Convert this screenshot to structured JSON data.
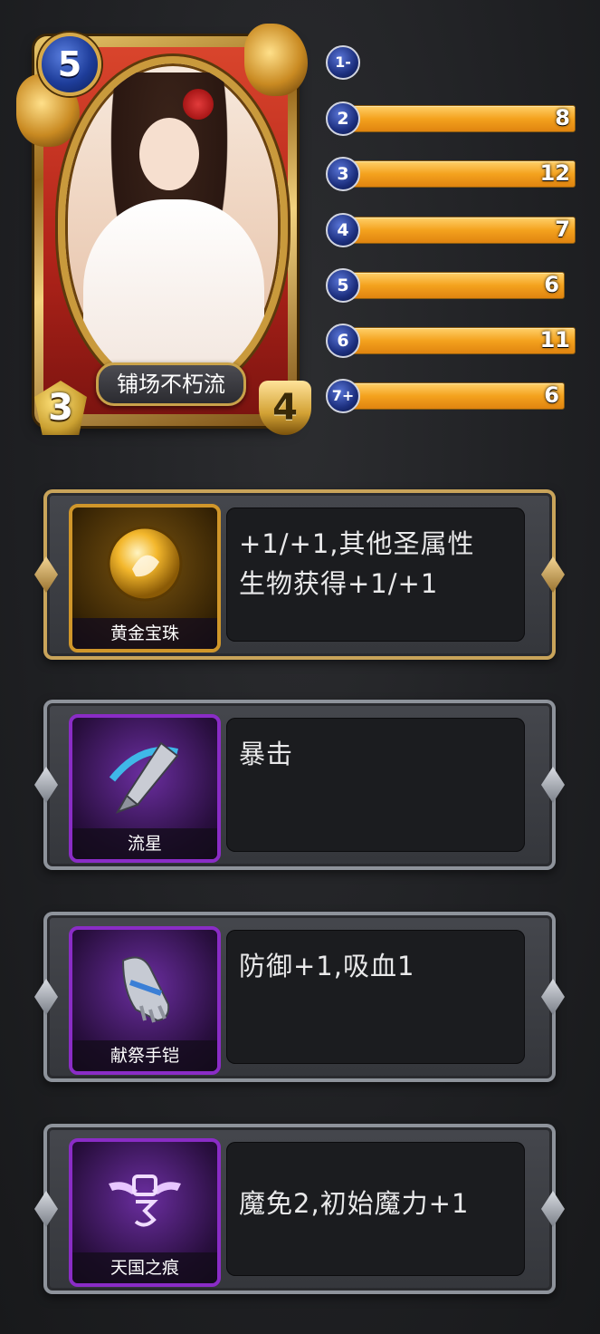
{
  "card": {
    "name": "铺场不朽流",
    "cost": "5",
    "attack": "3",
    "health": "4"
  },
  "cost_curve": [
    {
      "cost": "1-",
      "count": ""
    },
    {
      "cost": "2",
      "count": "8"
    },
    {
      "cost": "3",
      "count": "12"
    },
    {
      "cost": "4",
      "count": "7"
    },
    {
      "cost": "5",
      "count": "6"
    },
    {
      "cost": "6",
      "count": "11"
    },
    {
      "cost": "7+",
      "count": "6"
    }
  ],
  "equipment": [
    {
      "name": "黄金宝珠",
      "rarity": "gold",
      "icon": "golden-orb-icon",
      "desc_line1": "+1/+1,其他圣属性",
      "desc_line2": "生物获得+1/+1"
    },
    {
      "name": "流星",
      "rarity": "purple",
      "icon": "meteor-lance-icon",
      "desc_line1": "暴击",
      "desc_line2": ""
    },
    {
      "name": "献祭手铠",
      "rarity": "purple",
      "icon": "gauntlet-icon",
      "desc_line1": "防御+1,吸血1",
      "desc_line2": ""
    },
    {
      "name": "天国之痕",
      "rarity": "purple",
      "icon": "winged-emblem-icon",
      "desc_line1": "魔免2,初始魔力+1",
      "desc_line2": ""
    }
  ],
  "colors": {
    "bar": "#f4a21e",
    "gold_frame": "#c9a45a",
    "purple_frame": "#8a2cc6",
    "cost_orb": "#1c2f7e"
  }
}
